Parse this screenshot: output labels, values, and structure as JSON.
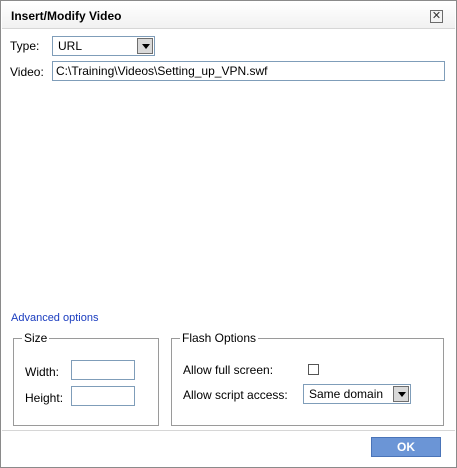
{
  "dialog": {
    "title": "Insert/Modify Video",
    "close_symbol": "✕"
  },
  "form": {
    "type_label": "Type:",
    "type_value": "URL",
    "video_label": "Video:",
    "video_value": "C:\\Training\\Videos\\Setting_up_VPN.swf"
  },
  "advanced_link": "Advanced options",
  "size": {
    "legend": "Size",
    "width_label": "Width:",
    "height_label": "Height:",
    "width_value": "",
    "height_value": ""
  },
  "flash": {
    "legend": "Flash Options",
    "fullscreen_label": "Allow full screen:",
    "fullscreen_checked": false,
    "script_access_label": "Allow script access:",
    "script_access_value": "Same domain"
  },
  "footer": {
    "ok_label": "OK"
  },
  "colors": {
    "ok_button": "#6b95d6",
    "link": "#1a3cbf",
    "input_border": "#7f9db9"
  }
}
